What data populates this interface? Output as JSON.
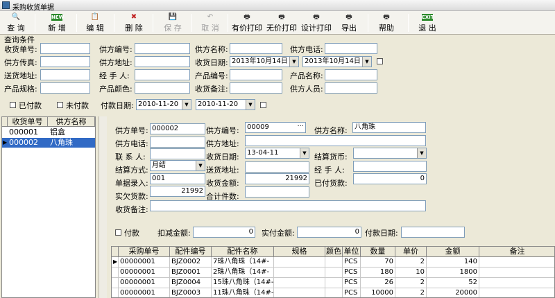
{
  "window": {
    "title": "采购收货单据"
  },
  "toolbar": {
    "query": "查 询",
    "add": "新 增",
    "edit": "编 辑",
    "delete": "删 除",
    "save": "保 存",
    "cancel": "取 消",
    "print_price": "有价打印",
    "print_noprice": "无价打印",
    "design_print": "设计打印",
    "export": "导出",
    "help": "帮助",
    "exit": "退 出",
    "new_badge": "NEW",
    "exit_badge": "EXIT"
  },
  "query": {
    "group_title": "查询条件",
    "receipt_no": "收货单号:",
    "supplier_code": "供方编号:",
    "supplier_name": "供方名称:",
    "supplier_phone": "供方电话:",
    "supplier_fax": "供方传真:",
    "supplier_addr": "供方地址:",
    "receive_date": "收货日期:",
    "receive_date_from": "2013年10月14日",
    "receive_date_to": "2013年10月14日",
    "delivery_addr": "送货地址:",
    "handler": "经 手 人:",
    "product_code": "产品编号:",
    "product_name": "产品名称:",
    "product_spec": "产品规格:",
    "product_color": "产品颜色:",
    "receive_remark": "收货备注:",
    "supplier_staff": "供方人员:",
    "paid": "已付款",
    "unpaid": "未付款",
    "pay_date": "付款日期:",
    "pay_date_from": "2010-11-20",
    "pay_date_to": "2010-11-20"
  },
  "list": {
    "headers": [
      "收货单号",
      "供方名称"
    ],
    "rows": [
      {
        "no": "000001",
        "name": "铝盒"
      },
      {
        "no": "000002",
        "name": "八角珠"
      }
    ]
  },
  "detail": {
    "receipt_no_label": "供方单号:",
    "receipt_no": "000002",
    "supplier_code_label": "供方编号:",
    "supplier_code": "00009",
    "supplier_name_label": "供方名称:",
    "supplier_name": "八角珠",
    "phone_label": "供方电话:",
    "addr_label": "供方地址:",
    "contact_label": "联 系 人:",
    "receive_date_label": "收货日期:",
    "receive_date": "13-04-11",
    "currency_label": "结算货币:",
    "settle_label": "结算方式:",
    "settle": "月结",
    "delivery_label": "送货地址:",
    "handler_label": "经 手 人:",
    "entry_label": "单据录入:",
    "entry": "001",
    "amount_label": "收货金额:",
    "amount": "21992",
    "paid_label": "已付货款:",
    "paid": "0",
    "owed_label": "实欠货款:",
    "owed": "21992",
    "count_label": "合计件数:",
    "remark_label": "收货备注:",
    "pay_chk": "付款",
    "deduct_label": "扣减金额:",
    "deduct": "0",
    "actual_label": "实付金额:",
    "actual": "0",
    "pay_date_label": "付款日期:",
    "browse_button": "···"
  },
  "grid": {
    "headers": [
      "采购单号",
      "配件编号",
      "配件名称",
      "规格",
      "颜色",
      "单位",
      "数量",
      "单价",
      "金额",
      "备注"
    ],
    "rows": [
      {
        "po": "00000001",
        "part": "BJZ0002",
        "name": "7珠八角珠（14#-",
        "spec": "",
        "color": "",
        "unit": "PCS",
        "qty": "70",
        "price": "2",
        "amount": "140",
        "note": ""
      },
      {
        "po": "00000001",
        "part": "BJZ0001",
        "name": "2珠八角珠（14#-",
        "spec": "",
        "color": "",
        "unit": "PCS",
        "qty": "180",
        "price": "10",
        "amount": "1800",
        "note": ""
      },
      {
        "po": "00000001",
        "part": "BJZ0004",
        "name": "15珠八角珠（14#-",
        "spec": "",
        "color": "",
        "unit": "PCS",
        "qty": "26",
        "price": "2",
        "amount": "52",
        "note": ""
      },
      {
        "po": "00000001",
        "part": "BJZ0003",
        "name": "11珠八角珠（14#-",
        "spec": "",
        "color": "",
        "unit": "PCS",
        "qty": "10000",
        "price": "2",
        "amount": "20000",
        "note": ""
      }
    ]
  }
}
